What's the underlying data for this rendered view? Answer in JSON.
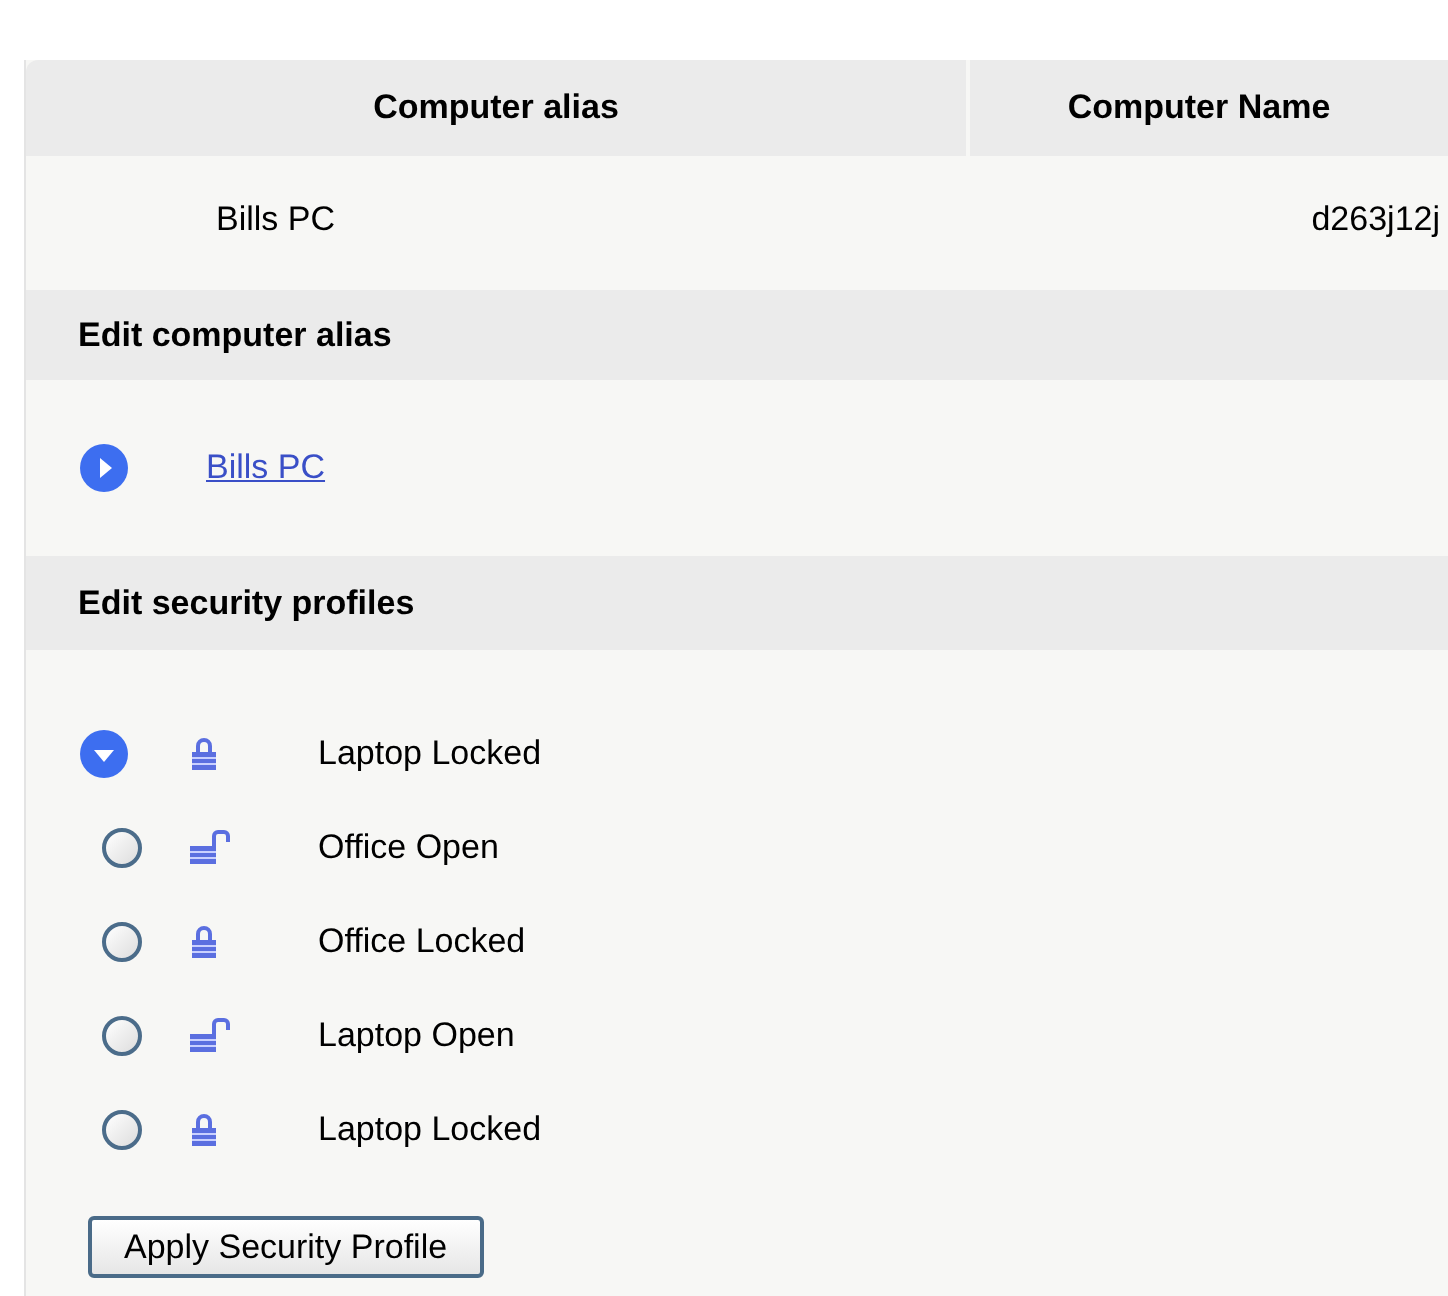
{
  "table": {
    "columns": [
      "Computer alias",
      "Computer Name"
    ],
    "rows": [
      {
        "alias": "Bills PC",
        "name": "d263j12j"
      }
    ]
  },
  "alias_section": {
    "title": "Edit computer alias",
    "link": "Bills PC"
  },
  "profiles_section": {
    "title": "Edit security profiles",
    "profiles": [
      {
        "label": "Laptop Locked",
        "locked": true,
        "selected": true
      },
      {
        "label": "Office Open",
        "locked": false,
        "selected": false
      },
      {
        "label": "Office Locked",
        "locked": true,
        "selected": false
      },
      {
        "label": "Laptop Open",
        "locked": false,
        "selected": false
      },
      {
        "label": "Laptop Locked",
        "locked": true,
        "selected": false
      }
    ]
  },
  "apply_button": "Apply Security Profile"
}
